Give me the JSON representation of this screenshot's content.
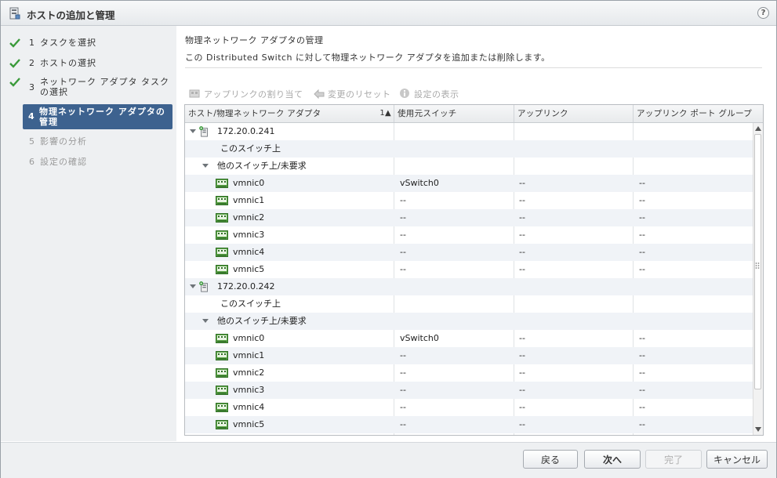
{
  "dialog": {
    "title": "ホストの追加と管理",
    "help": "?"
  },
  "nav": {
    "steps": [
      {
        "num": "1",
        "label": "タスクを選択",
        "done": true
      },
      {
        "num": "2",
        "label": "ホストの選択",
        "done": true
      },
      {
        "num": "3",
        "label": "ネットワーク アダプタ タスク\nの選択",
        "done": true
      },
      {
        "num": "4",
        "label": "物理ネットワーク アダプタの\n管理",
        "active": true
      },
      {
        "num": "5",
        "label": "影響の分析",
        "disabled": true
      },
      {
        "num": "6",
        "label": "設定の確認",
        "disabled": true
      }
    ]
  },
  "content": {
    "title": "物理ネットワーク アダプタの管理",
    "description": "この Distributed Switch に対して物理ネットワーク アダプタを追加または削除します。",
    "toolbar": {
      "assign": "アップリンクの割り当て",
      "reset": "変更のリセット",
      "view": "設定の表示"
    }
  },
  "grid": {
    "columns": [
      "ホスト/物理ネットワーク アダプタ",
      "使用元スイッチ",
      "アップリンク",
      "アップリンク ポート グループ"
    ],
    "sort_indicator": "1▲",
    "rows": [
      {
        "type": "host",
        "name": "172.20.0.241",
        "switch": "",
        "uplink": "",
        "pg": ""
      },
      {
        "type": "group-static",
        "name": "このスイッチ上",
        "switch": "",
        "uplink": "",
        "pg": ""
      },
      {
        "type": "group",
        "name": "他のスイッチ上/未要求",
        "switch": "",
        "uplink": "",
        "pg": ""
      },
      {
        "type": "nic",
        "name": "vmnic0",
        "switch": "vSwitch0",
        "uplink": "--",
        "pg": "--"
      },
      {
        "type": "nic",
        "name": "vmnic1",
        "switch": "--",
        "uplink": "--",
        "pg": "--"
      },
      {
        "type": "nic",
        "name": "vmnic2",
        "switch": "--",
        "uplink": "--",
        "pg": "--"
      },
      {
        "type": "nic",
        "name": "vmnic3",
        "switch": "--",
        "uplink": "--",
        "pg": "--"
      },
      {
        "type": "nic",
        "name": "vmnic4",
        "switch": "--",
        "uplink": "--",
        "pg": "--"
      },
      {
        "type": "nic",
        "name": "vmnic5",
        "switch": "--",
        "uplink": "--",
        "pg": "--"
      },
      {
        "type": "host",
        "name": "172.20.0.242",
        "switch": "",
        "uplink": "",
        "pg": ""
      },
      {
        "type": "group-static",
        "name": "このスイッチ上",
        "switch": "",
        "uplink": "",
        "pg": ""
      },
      {
        "type": "group",
        "name": "他のスイッチ上/未要求",
        "switch": "",
        "uplink": "",
        "pg": ""
      },
      {
        "type": "nic",
        "name": "vmnic0",
        "switch": "vSwitch0",
        "uplink": "--",
        "pg": "--"
      },
      {
        "type": "nic",
        "name": "vmnic1",
        "switch": "--",
        "uplink": "--",
        "pg": "--"
      },
      {
        "type": "nic",
        "name": "vmnic2",
        "switch": "--",
        "uplink": "--",
        "pg": "--"
      },
      {
        "type": "nic",
        "name": "vmnic3",
        "switch": "--",
        "uplink": "--",
        "pg": "--"
      },
      {
        "type": "nic",
        "name": "vmnic4",
        "switch": "--",
        "uplink": "--",
        "pg": "--"
      },
      {
        "type": "nic",
        "name": "vmnic5",
        "switch": "--",
        "uplink": "--",
        "pg": "--"
      }
    ]
  },
  "footer": {
    "back": "戻る",
    "next": "次へ",
    "finish": "完了",
    "cancel": "キャンセル"
  },
  "colors": {
    "active_step": "#3d628f",
    "check": "#3a9a3a",
    "row_alt": "#f0f3f7"
  }
}
